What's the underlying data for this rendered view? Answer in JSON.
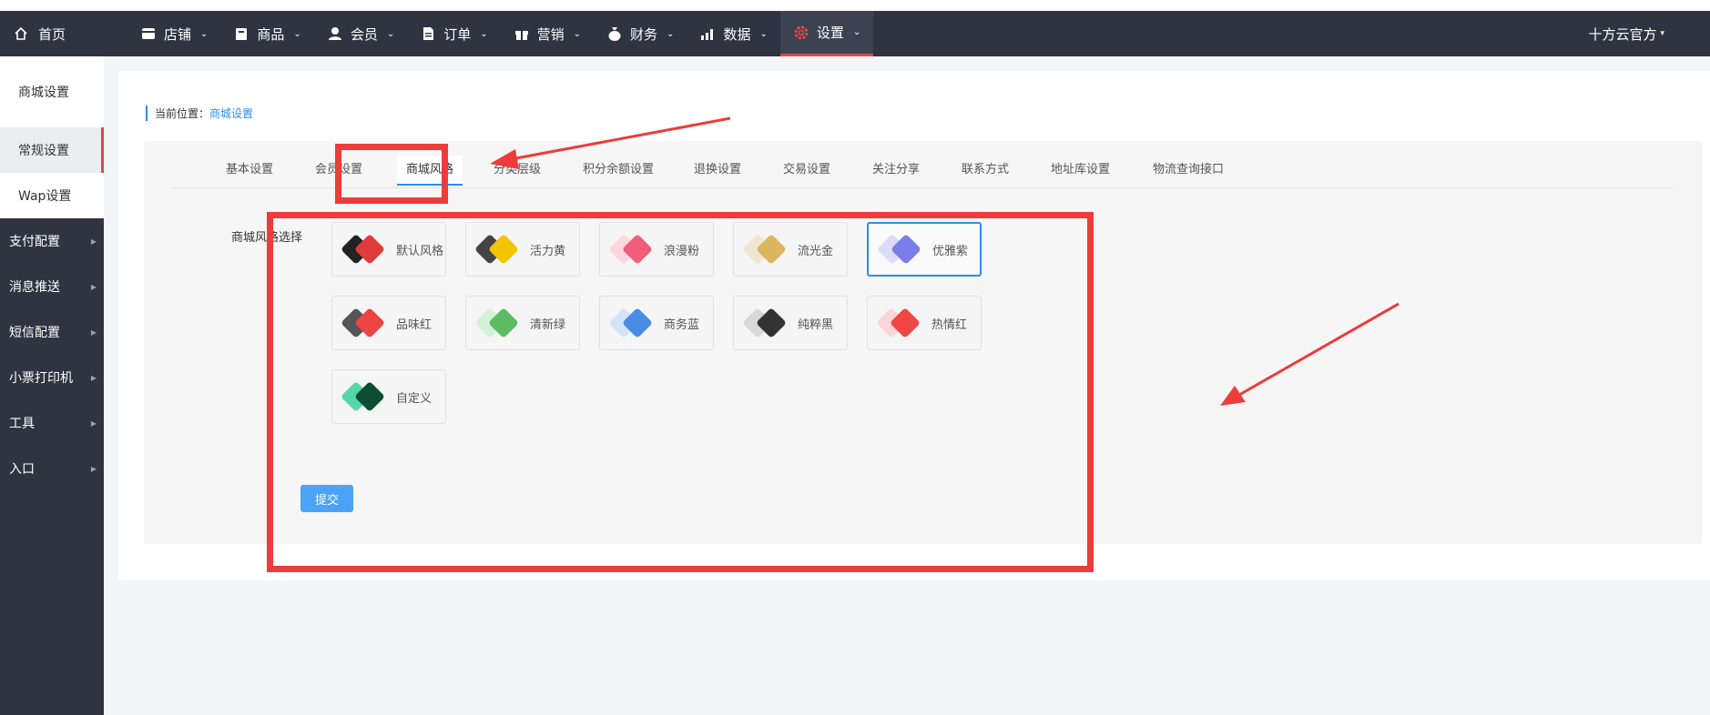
{
  "topnav": {
    "home_label": "首页",
    "items": [
      {
        "label": "店铺",
        "icon": "store-icon"
      },
      {
        "label": "商品",
        "icon": "bag-icon"
      },
      {
        "label": "会员",
        "icon": "user-icon"
      },
      {
        "label": "订单",
        "icon": "document-icon"
      },
      {
        "label": "营销",
        "icon": "gift-icon"
      },
      {
        "label": "财务",
        "icon": "money-bag-icon"
      },
      {
        "label": "数据",
        "icon": "bar-chart-icon"
      },
      {
        "label": "设置",
        "icon": "gear-icon",
        "active": true
      }
    ],
    "user_label": "十方云官方"
  },
  "sidebar": {
    "items": [
      {
        "label": "商城设置"
      },
      {
        "label": "常规设置",
        "active": true
      },
      {
        "label": "Wap设置"
      },
      {
        "label": "支付配置"
      },
      {
        "label": "消息推送"
      },
      {
        "label": "短信配置"
      },
      {
        "label": "小票打印机"
      },
      {
        "label": "工具"
      },
      {
        "label": "入口"
      }
    ]
  },
  "breadcrumb": {
    "prefix": "当前位置：",
    "current": "商城设置"
  },
  "tabs": [
    {
      "label": "基本设置"
    },
    {
      "label": "会员设置"
    },
    {
      "label": "商城风格",
      "active": true
    },
    {
      "label": "分类层级"
    },
    {
      "label": "积分余额设置"
    },
    {
      "label": "退换设置"
    },
    {
      "label": "交易设置"
    },
    {
      "label": "关注分享"
    },
    {
      "label": "联系方式"
    },
    {
      "label": "地址库设置"
    },
    {
      "label": "物流查询接口"
    }
  ],
  "form": {
    "field_label": "商城风格选择",
    "styles": [
      {
        "label": "默认风格",
        "back": "#222222",
        "front": "#e03b3b"
      },
      {
        "label": "活力黄",
        "back": "#444444",
        "front": "#f5c400"
      },
      {
        "label": "浪漫粉",
        "back": "#ffd6dd",
        "front": "#f25d7a"
      },
      {
        "label": "流光金",
        "back": "#efe6d0",
        "front": "#dbb55f"
      },
      {
        "label": "优雅紫",
        "back": "#dcdcfa",
        "front": "#7b7de8",
        "selected": true
      },
      {
        "label": "品味红",
        "back": "#555555",
        "front": "#ee4444"
      },
      {
        "label": "清新绿",
        "back": "#d6f1d9",
        "front": "#5dbb63"
      },
      {
        "label": "商务蓝",
        "back": "#d4e3fa",
        "front": "#4a8ce3"
      },
      {
        "label": "纯粹黑",
        "back": "#d8d8d8",
        "front": "#333333"
      },
      {
        "label": "热情红",
        "back": "#ffd4d4",
        "front": "#f04545"
      },
      {
        "label": "自定义",
        "back": "#57d6a8",
        "front": "#0d4d32"
      }
    ],
    "submit_label": "提交"
  },
  "colors": {
    "nav_bg": "#2f3440",
    "accent_blue": "#2d8cf0",
    "accent_red": "#e64545",
    "annotation_red": "#ee3b3b"
  }
}
